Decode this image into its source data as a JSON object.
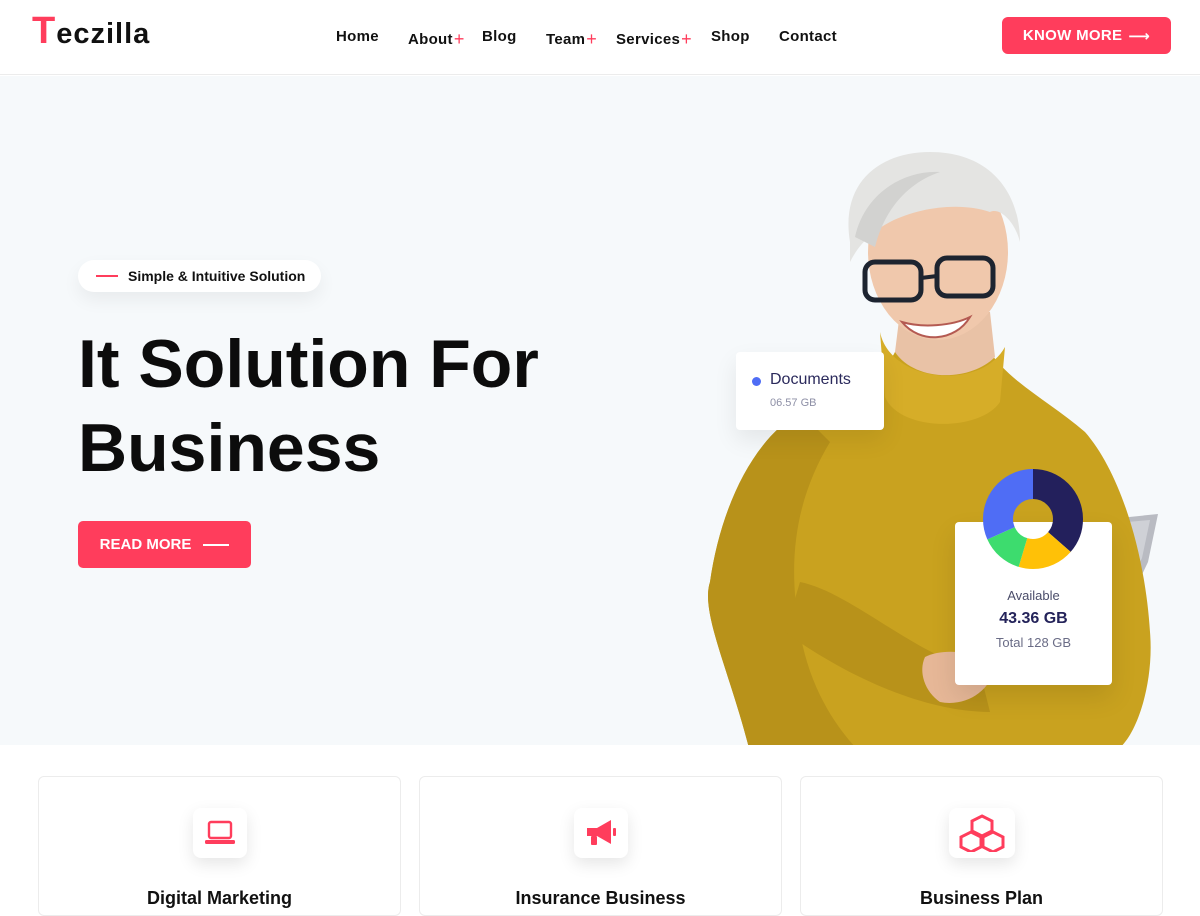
{
  "header": {
    "logo_first": "T",
    "logo_rest": "eczilla",
    "nav": [
      {
        "label": "Home",
        "has_sub": false
      },
      {
        "label": "About",
        "has_sub": true
      },
      {
        "label": "Blog",
        "has_sub": false
      },
      {
        "label": "Team",
        "has_sub": true
      },
      {
        "label": "Services",
        "has_sub": true
      },
      {
        "label": "Shop",
        "has_sub": false
      },
      {
        "label": "Contact",
        "has_sub": false
      }
    ],
    "plus_symbol": "+",
    "cta_label": "KNOW MORE",
    "cta_arrow": "⟶"
  },
  "hero": {
    "tagline": "Simple & Intuitive Solution",
    "title_line1": "It Solution For",
    "title_line2": "Business",
    "button_label": "READ MORE"
  },
  "illustration": {
    "documents_label": "Documents",
    "documents_size": "06.57 GB",
    "available_label": "Available",
    "available_amount": "43.36 GB",
    "total_label": "Total 128 GB",
    "donut_colors": [
      "#23205c",
      "#ffc107",
      "#3ddc6e",
      "#4f6df5"
    ]
  },
  "services": [
    {
      "title": "Digital Marketing",
      "icon": "laptop-icon"
    },
    {
      "title": "Insurance Business",
      "icon": "megaphone-icon"
    },
    {
      "title": "Business Plan",
      "icon": "boxes-icon"
    }
  ],
  "colors": {
    "accent": "#ff3d5c",
    "hero_bg": "#f6f9fb",
    "sweater": "#c9a21f"
  }
}
